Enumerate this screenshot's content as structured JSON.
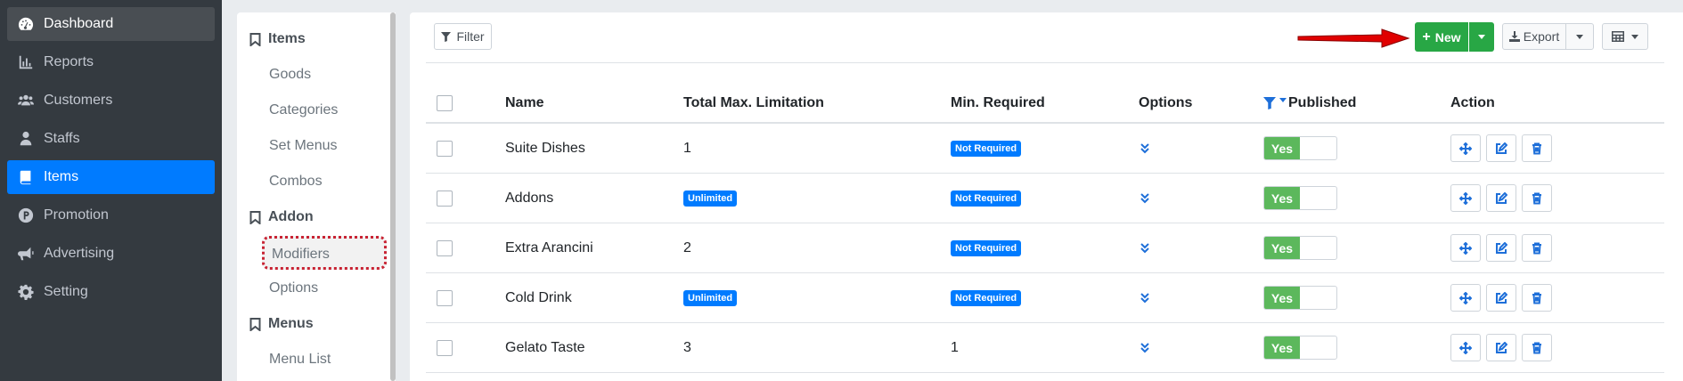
{
  "sidebar": {
    "items": [
      {
        "label": "Dashboard",
        "icon": "gauge-icon"
      },
      {
        "label": "Reports",
        "icon": "bar-chart-icon"
      },
      {
        "label": "Customers",
        "icon": "users-icon"
      },
      {
        "label": "Staffs",
        "icon": "person-icon"
      },
      {
        "label": "Items",
        "icon": "book-icon"
      },
      {
        "label": "Promotion",
        "icon": "p-circle-icon"
      },
      {
        "label": "Advertising",
        "icon": "megaphone-icon"
      },
      {
        "label": "Setting",
        "icon": "gear-icon"
      }
    ]
  },
  "submenu": {
    "sections": [
      {
        "title": "Items",
        "links": [
          "Goods",
          "Categories",
          "Set Menus",
          "Combos"
        ]
      },
      {
        "title": "Addon",
        "links": [
          "Modifiers",
          "Options"
        ]
      },
      {
        "title": "Menus",
        "links": [
          "Menu List"
        ]
      }
    ]
  },
  "toolbar": {
    "filter_label": "Filter",
    "new_label": "New",
    "export_label": "Export"
  },
  "table": {
    "headers": {
      "name": "Name",
      "total": "Total Max. Limitation",
      "min": "Min. Required",
      "options": "Options",
      "published": "Published",
      "action": "Action"
    },
    "rows": [
      {
        "name": "Suite Dishes",
        "total": "1",
        "total_badge": false,
        "min": "Not Required",
        "min_badge": true,
        "published": "Yes"
      },
      {
        "name": "Addons",
        "total": "Unlimited",
        "total_badge": true,
        "min": "Not Required",
        "min_badge": true,
        "published": "Yes"
      },
      {
        "name": "Extra Arancini",
        "total": "2",
        "total_badge": false,
        "min": "Not Required",
        "min_badge": true,
        "published": "Yes"
      },
      {
        "name": "Cold Drink",
        "total": "Unlimited",
        "total_badge": true,
        "min": "Not Required",
        "min_badge": true,
        "published": "Yes"
      },
      {
        "name": "Gelato Taste",
        "total": "3",
        "total_badge": false,
        "min": "1",
        "min_badge": false,
        "published": "Yes"
      }
    ]
  },
  "colors": {
    "sidebar_bg": "#343a40",
    "active": "#007bff",
    "success": "#28a745",
    "toggle_on": "#5cb85c",
    "highlight_border": "#c82333",
    "arrow": "#e00000"
  }
}
